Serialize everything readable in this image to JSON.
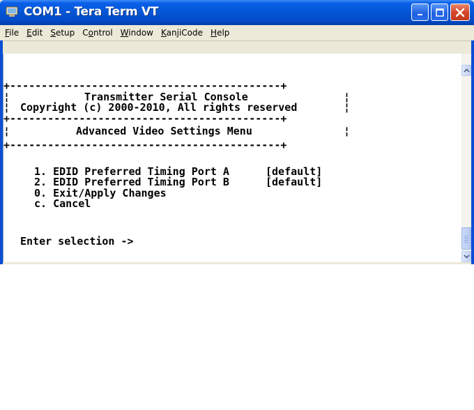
{
  "window": {
    "title": "COM1 - Tera Term VT",
    "controls": [
      "minimize-icon",
      "maximize-icon",
      "close-icon"
    ]
  },
  "menu": [
    {
      "label": "File",
      "underline_index": 0
    },
    {
      "label": "Edit",
      "underline_index": 0
    },
    {
      "label": "Setup",
      "underline_index": 0
    },
    {
      "label": "Control",
      "underline_index": 1
    },
    {
      "label": "Window",
      "underline_index": 0
    },
    {
      "label": "KanjiCode",
      "underline_index": 0
    },
    {
      "label": "Help",
      "underline_index": 0
    }
  ],
  "terminal": {
    "lines": [
      "+-------------------------------------------+",
      "¦        Transmitter Serial Console         ¦",
      "¦ Copyright (c) 2000-2010, All rights reserved ¦",
      "+-------------------------------------------+",
      "¦          Advanced Video Settings Menu      ¦",
      "+-------------------------------------------+",
      "",
      "    1. EDID Preferred Timing Port A  [default]",
      "    2. EDID Preferred Timing Port B  [default]",
      "    0. Exit/Apply Changes",
      "    c. Cancel",
      "",
      " Enter selection ->"
    ],
    "header_title": "Transmitter Serial Console",
    "copyright": "Copyright (c) 2000-2010, All rights reserved",
    "menu_title": "Advanced Video Settings Menu",
    "options": [
      {
        "key": "1.",
        "label": "EDID Preferred Timing Port A",
        "value": "[default]"
      },
      {
        "key": "2.",
        "label": "EDID Preferred Timing Port B",
        "value": "[default]"
      },
      {
        "key": "0.",
        "label": "Exit/Apply Changes",
        "value": ""
      },
      {
        "key": "c.",
        "label": "Cancel",
        "value": ""
      }
    ],
    "prompt": "Enter selection ->"
  },
  "colors": {
    "titlebar": "#0556d6",
    "close_button": "#d5462a",
    "terminal_bg": "#ffffff",
    "terminal_fg": "#000000",
    "chrome": "#ece9d8"
  }
}
